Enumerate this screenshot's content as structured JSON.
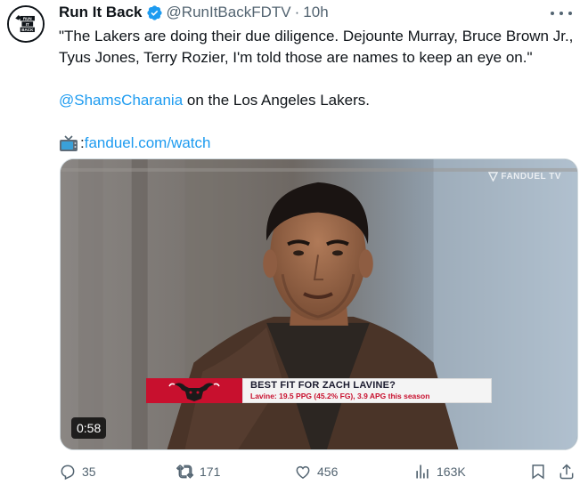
{
  "author": {
    "name": "Run It Back",
    "handle": "@RunItBackFDTV",
    "separator": "·",
    "time": "10h",
    "avatar_text": [
      "RUN",
      "IT",
      "BACK"
    ]
  },
  "tweet": {
    "line1": "\"The Lakers are doing their due diligence. Dejounte Murray, Bruce Brown Jr., Tyus Jones, Terry Rozier, I'm told those are names to keep an eye on.\"",
    "mention": "@ShamsCharania",
    "mention_rest": " on the Los Angeles Lakers.",
    "link_prefix": ":",
    "link": "fanduel.com/watch"
  },
  "video": {
    "watermark": "FANDUEL TV",
    "duration": "0:58",
    "lower_third_title": "BEST FIT FOR ZACH LAVINE?",
    "lower_third_sub": "Lavine: 19.5 PPG (45.2% FG), 3.9 APG this season"
  },
  "actions": {
    "replies": "35",
    "reposts": "171",
    "likes": "456",
    "views": "163K"
  },
  "colors": {
    "accent": "#1d9bf0",
    "muted": "#536471",
    "bulls_red": "#c8102e"
  },
  "icons": [
    "verified-badge-icon",
    "more-icon",
    "tv-icon",
    "fanduel-logo-icon",
    "bulls-logo-icon",
    "reply-icon",
    "repost-icon",
    "like-icon",
    "views-icon",
    "bookmark-icon",
    "share-icon"
  ]
}
